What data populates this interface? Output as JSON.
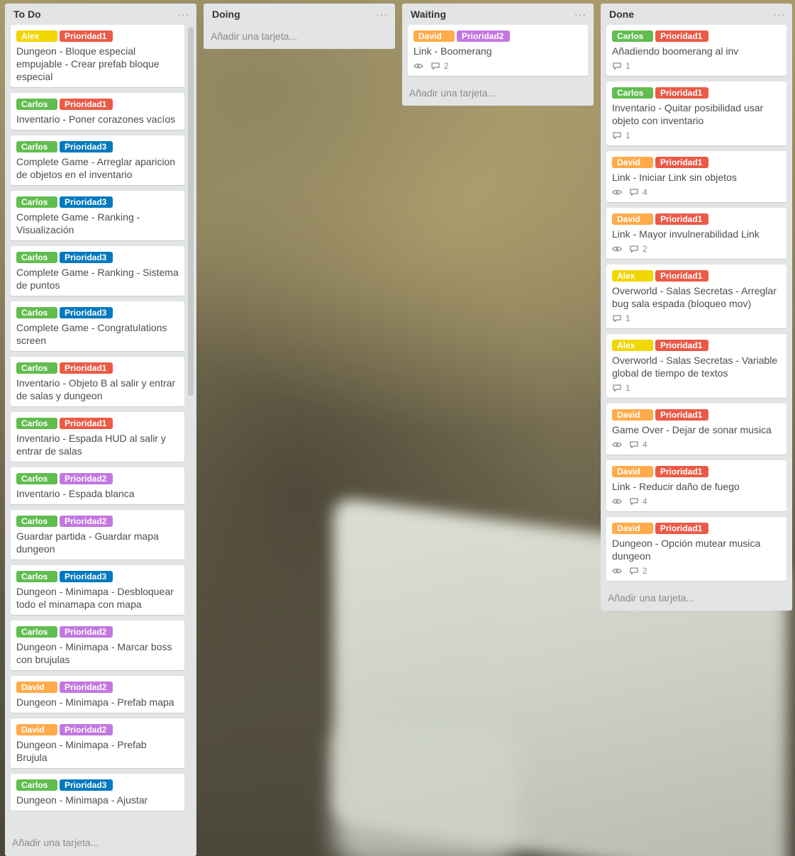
{
  "colors": {
    "Alex": "#f2d600",
    "Carlos": "#61bd4f",
    "David": "#ffab4a",
    "Prioridad1": "#eb5a46",
    "Prioridad2": "#c377e0",
    "Prioridad3": "#0079bf"
  },
  "add_card_label": "Añadir una tarjeta...",
  "menu_label": "···",
  "lists": [
    {
      "title": "To Do",
      "cards": [
        {
          "person": "Alex",
          "priority": "Prioridad1",
          "title": "Dungeon - Bloque especial empujable - Crear prefab bloque especial"
        },
        {
          "person": "Carlos",
          "priority": "Prioridad1",
          "title": "Inventario - Poner corazones vacíos"
        },
        {
          "person": "Carlos",
          "priority": "Prioridad3",
          "title": "Complete Game - Arreglar aparicion de objetos en el inventario"
        },
        {
          "person": "Carlos",
          "priority": "Prioridad3",
          "title": "Complete Game - Ranking - Visualización"
        },
        {
          "person": "Carlos",
          "priority": "Prioridad3",
          "title": "Complete Game - Ranking - Sistema de puntos"
        },
        {
          "person": "Carlos",
          "priority": "Prioridad3",
          "title": "Complete Game - Congratulations screen"
        },
        {
          "person": "Carlos",
          "priority": "Prioridad1",
          "title": "Inventario - Objeto B al salir y entrar de salas y dungeon"
        },
        {
          "person": "Carlos",
          "priority": "Prioridad1",
          "title": "Inventario - Espada HUD al salir y entrar de salas"
        },
        {
          "person": "Carlos",
          "priority": "Prioridad2",
          "title": "Inventario - Espada blanca"
        },
        {
          "person": "Carlos",
          "priority": "Prioridad2",
          "title": "Guardar partida - Guardar mapa dungeon"
        },
        {
          "person": "Carlos",
          "priority": "Prioridad3",
          "title": "Dungeon - Minimapa - Desbloquear todo el minamapa con mapa"
        },
        {
          "person": "Carlos",
          "priority": "Prioridad2",
          "title": "Dungeon - Minimapa - Marcar boss con brujulas"
        },
        {
          "person": "David",
          "priority": "Prioridad2",
          "title": "Dungeon - Minimapa - Prefab mapa"
        },
        {
          "person": "David",
          "priority": "Prioridad2",
          "title": "Dungeon - Minimapa - Prefab Brujula"
        },
        {
          "person": "Carlos",
          "priority": "Prioridad3",
          "title": "Dungeon - Minimapa - Ajustar"
        }
      ]
    },
    {
      "title": "Doing",
      "cards": []
    },
    {
      "title": "Waiting",
      "cards": [
        {
          "person": "David",
          "priority": "Prioridad2",
          "title": "Link - Boomerang",
          "watch": true,
          "comments": "2"
        }
      ]
    },
    {
      "title": "Done",
      "cards": [
        {
          "person": "Carlos",
          "priority": "Prioridad1",
          "title": "Añadiendo boomerang al inv",
          "comments": "1"
        },
        {
          "person": "Carlos",
          "priority": "Prioridad1",
          "title": "Inventario - Quitar posibilidad usar objeto con inventario",
          "comments": "1"
        },
        {
          "person": "David",
          "priority": "Prioridad1",
          "title": "Link - Iniciar Link sin objetos",
          "watch": true,
          "comments": "4"
        },
        {
          "person": "David",
          "priority": "Prioridad1",
          "title": "Link - Mayor invulnerabilidad Link",
          "watch": true,
          "comments": "2"
        },
        {
          "person": "Alex",
          "priority": "Prioridad1",
          "title": "Overworld - Salas Secretas - Arreglar bug sala espada (bloqueo mov)",
          "comments": "1"
        },
        {
          "person": "Alex",
          "priority": "Prioridad1",
          "title": "Overworld - Salas Secretas - Variable global de tiempo de textos",
          "comments": "1"
        },
        {
          "person": "David",
          "priority": "Prioridad1",
          "title": "Game Over - Dejar de sonar musica",
          "watch": true,
          "comments": "4"
        },
        {
          "person": "David",
          "priority": "Prioridad1",
          "title": "Link - Reducir daño de fuego",
          "watch": true,
          "comments": "4"
        },
        {
          "person": "David",
          "priority": "Prioridad1",
          "title": "Dungeon - Opción mutear musica dungeon",
          "watch": true,
          "comments": "2"
        }
      ]
    }
  ]
}
